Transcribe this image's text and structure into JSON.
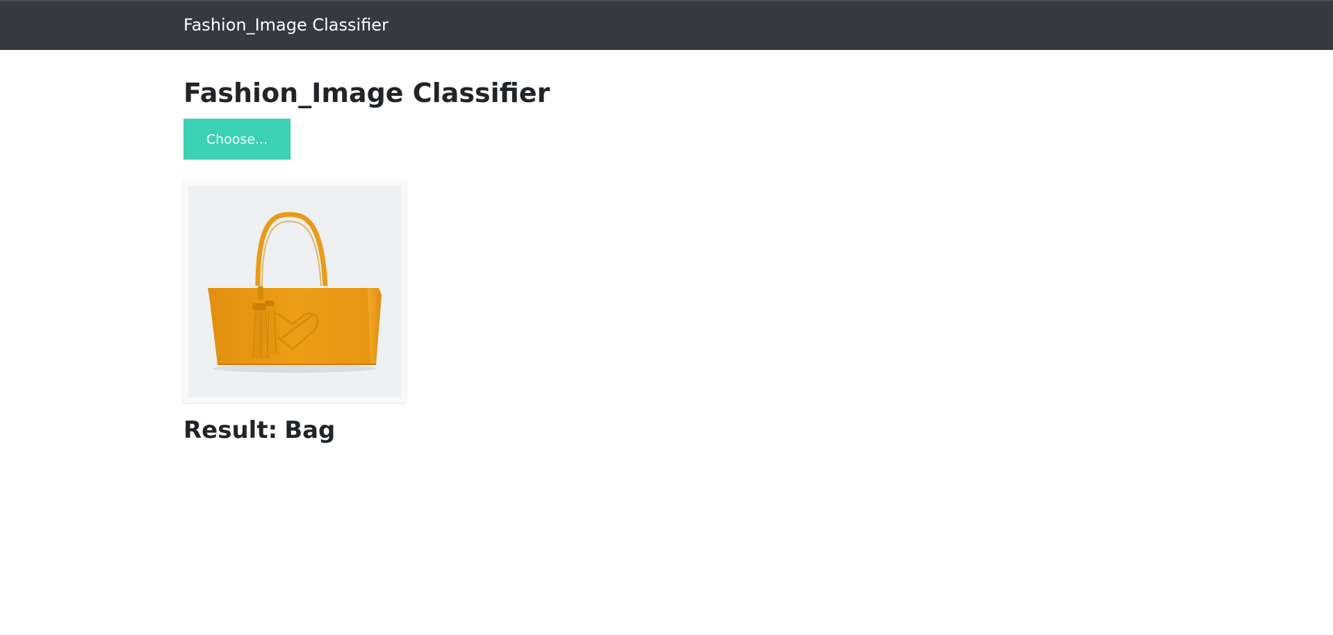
{
  "navbar": {
    "brand": "Fashion_Image Classifier"
  },
  "main": {
    "title": "Fashion_Image Classifier",
    "choose_button_label": "Choose...",
    "result_label": "Result:",
    "result_value": "Bag"
  },
  "colors": {
    "navbar_bg": "#343a40",
    "button_bg": "#3ad1b4",
    "bag_color": "#e79a14"
  },
  "icons": {
    "preview_image": "yellow-tote-bag-image"
  }
}
